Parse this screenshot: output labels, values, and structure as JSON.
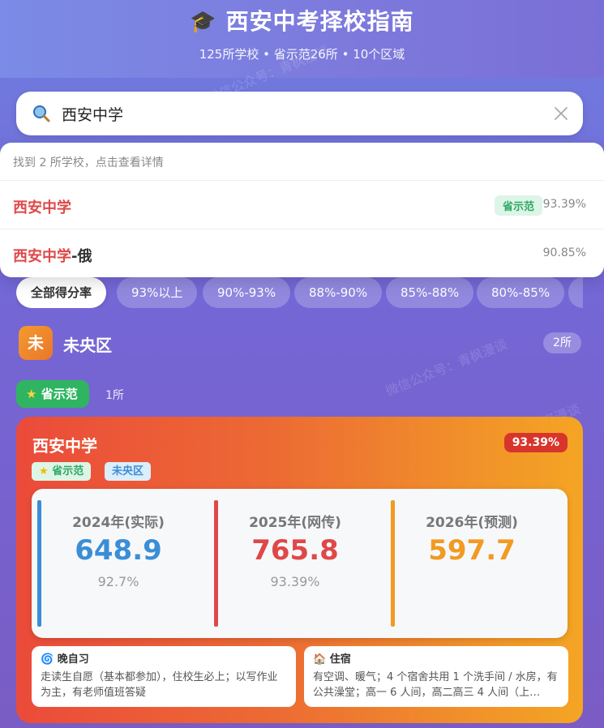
{
  "header": {
    "icon": "graduation-cap-icon",
    "title": "西安中考择校指南",
    "subtitle": "125所学校 • 省示范26所 • 10个区域"
  },
  "search": {
    "value": "西安中学",
    "placeholder": "",
    "icon": "search-icon",
    "clear_icon": "close-icon"
  },
  "dropdown": {
    "hint": "找到 2 所学校，点击查看详情",
    "results": [
      {
        "name_highlight": "西安中学",
        "name_rest": "",
        "badge": "省示范",
        "pct": "93.39%"
      },
      {
        "name_highlight": "西安中学",
        "name_rest": "-俄",
        "badge": "",
        "pct": "90.85%"
      }
    ]
  },
  "filters": [
    "全部得分率",
    "93%以上",
    "90%-93%",
    "88%-90%",
    "85%-88%",
    "80%-85%",
    ""
  ],
  "district": {
    "initial": "未",
    "name": "未央区",
    "count": "2所"
  },
  "category": {
    "label": "省示范",
    "icon": "star-icon",
    "count": "1所"
  },
  "card": {
    "name": "西安中学",
    "pct": "93.39%",
    "tags": [
      "省示范",
      "未央区"
    ],
    "scores": [
      {
        "label": "2024年(实际)",
        "value": "648.9",
        "rate": "92.7%",
        "color": "#3b8ed6"
      },
      {
        "label": "2025年(网传)",
        "value": "765.8",
        "rate": "93.39%",
        "color": "#e04848"
      },
      {
        "label": "2026年(预测)",
        "value": "597.7",
        "rate": "",
        "color": "#f29a22"
      }
    ],
    "evening_study": {
      "icon": "spiral-icon",
      "title": "晚自习",
      "text": "走读生自愿（基本都参加），住校生必上；以写作业为主，有老师值班答疑"
    },
    "dorm": {
      "icon": "house-icon",
      "title": "住宿",
      "text": "有空调、暖气；4 个宿舍共用 1 个洗手间 / 水房，有公共澡堂；高一 6 人间，高二高三 4 人间（上…"
    }
  },
  "watermark": "微信公众号：青枫漫谈",
  "colors": {
    "accent_red": "#e04848",
    "accent_green": "#2fb561",
    "accent_blue": "#3b8ed6",
    "accent_orange": "#f29a22"
  }
}
